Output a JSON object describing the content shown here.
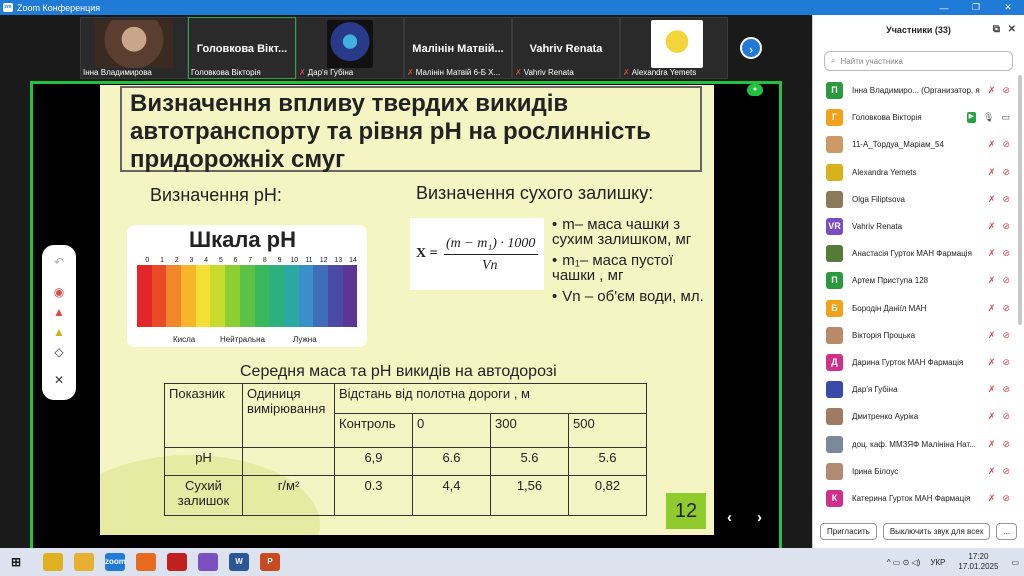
{
  "window": {
    "title": "Zoom Конференция",
    "app_icon_text": "zm"
  },
  "window_buttons": {
    "minimize": "—",
    "maximize": "❐",
    "close": "✕"
  },
  "thumbnails": [
    {
      "big_name": "",
      "caption": "Інна Владимирова",
      "muted": false
    },
    {
      "big_name": "Головкова Вікт...",
      "caption": "Головкова Вікторія",
      "muted": false
    },
    {
      "big_name": "",
      "caption": "Дар'я Губіна",
      "muted": true
    },
    {
      "big_name": "Малінін Матвій...",
      "caption": "Малінін Матвій 6-Б Х...",
      "muted": true
    },
    {
      "big_name": "Vahriv Renata",
      "caption": "Vahriv Renata",
      "muted": true
    },
    {
      "big_name": "",
      "caption": "Alexandra Yemets",
      "muted": true
    }
  ],
  "next_page_icon": "›",
  "slide": {
    "title": "Визначення впливу твердих викидів автотранспорту та рівня рН на рослинність придорожніх смуг",
    "heading_ph": "Визначення рН:",
    "heading_dry": "Визначення сухого залишку:",
    "scale_title": "Шкала рН",
    "scale_numbers": [
      "0",
      "1",
      "2",
      "3",
      "4",
      "5",
      "6",
      "7",
      "8",
      "9",
      "10",
      "11",
      "12",
      "13",
      "14"
    ],
    "scale_colors": [
      "#e3262a",
      "#ea4a26",
      "#f2862a",
      "#f7b52b",
      "#f4e034",
      "#c8dc2e",
      "#8ccf33",
      "#5cc245",
      "#3ab75a",
      "#2fae7e",
      "#2ca8a4",
      "#3a8fc8",
      "#3f6db8",
      "#4a4ba4",
      "#5b3595"
    ],
    "scale_acid": "Кисла",
    "scale_neutral": "Нейтральна",
    "scale_alkaline": "Лужна",
    "formula_x": "X =",
    "formula_num": "(m − m₁) · 1000",
    "formula_den": "Vn",
    "bullets": [
      "m– маса чашки з сухим залишком, мг",
      "m₁– маса пустої чашки , мг",
      "Vn – об'єм води, мл."
    ],
    "table_caption": "Середня маса та рН викидів на автодорозі",
    "table": {
      "h_indicator": "Показник",
      "h_unit": "Одиниця вимірювання",
      "h_distance": "Відстань від полотна дороги , м",
      "cols": [
        "Контроль",
        "0",
        "300",
        "500"
      ],
      "rows": [
        {
          "name": "pH",
          "unit": "",
          "values": [
            "6,9",
            "6.6",
            "5.6",
            "5.6"
          ]
        },
        {
          "name": "Сухий залишок",
          "unit": "г/м²",
          "values": [
            "0.3",
            "4,4",
            "1,56",
            "0,82"
          ]
        }
      ]
    },
    "page_number": "12",
    "prev_icon": "‹",
    "next_icon": "›"
  },
  "annotation_tools": {
    "undo": "↶",
    "spotlight": "◉",
    "pen": "▲",
    "highlighter": "▲",
    "eraser": "◇",
    "close": "✕"
  },
  "panel": {
    "title": "Участники (33)",
    "search_placeholder": "Найти участника",
    "search_icon": "⌕",
    "popout_icon": "⧉",
    "close_icon": "✕",
    "participants": [
      {
        "initial": "П",
        "color": "#2b9a3e",
        "name": "Інна Владимиро... (Организатор, я)",
        "mic": "off",
        "cam": "off"
      },
      {
        "initial": "Г",
        "color": "#f0a21a",
        "name": "Головкова Вікторія",
        "mic": "on",
        "cam": "on"
      },
      {
        "initial": "",
        "color": "#c96",
        "name": "11-А_Тордуа_Маріам_54",
        "mic": "off",
        "cam": "off"
      },
      {
        "initial": "",
        "color": "#d8b21a",
        "name": "Alexandra Yemets",
        "mic": "off",
        "cam": "off"
      },
      {
        "initial": "",
        "color": "#8a7a5a",
        "name": "Olga Filiptsova",
        "mic": "off",
        "cam": "off"
      },
      {
        "initial": "VR",
        "color": "#7a4cc0",
        "name": "Vahriv Renata",
        "mic": "off",
        "cam": "off"
      },
      {
        "initial": "",
        "color": "#557a3a",
        "name": "Анастасія Гурток МАН Фармація",
        "mic": "off",
        "cam": "off"
      },
      {
        "initial": "П",
        "color": "#2b9a3e",
        "name": "Артем Приступа 128",
        "mic": "off",
        "cam": "off"
      },
      {
        "initial": "Б",
        "color": "#f0a21a",
        "name": "Бородін Даніїл МАН",
        "mic": "off",
        "cam": "off"
      },
      {
        "initial": "",
        "color": "#b98a6a",
        "name": "Вікторія Процька",
        "mic": "off",
        "cam": "off"
      },
      {
        "initial": "Д",
        "color": "#d0308a",
        "name": "Дарина Гурток МАН Фармація",
        "mic": "off",
        "cam": "off"
      },
      {
        "initial": "",
        "color": "#3a4aa8",
        "name": "Дар'я Губіна",
        "mic": "off",
        "cam": "off"
      },
      {
        "initial": "",
        "color": "#a07a62",
        "name": "Дмитренко Ауріка",
        "mic": "off",
        "cam": "off"
      },
      {
        "initial": "",
        "color": "#7a8a9a",
        "name": "доц. каф. ММЗЯФ Малініна Нат...",
        "mic": "off",
        "cam": "off"
      },
      {
        "initial": "",
        "color": "#b08a72",
        "name": "Ірина Білоус",
        "mic": "off",
        "cam": "off"
      },
      {
        "initial": "К",
        "color": "#d0308a",
        "name": "Катерина Гурток МАН Фармація",
        "mic": "off",
        "cam": "off"
      }
    ],
    "invite_label": "Пригласить",
    "mute_all_label": "Выключить звук для всех",
    "more_label": "..."
  },
  "taskbar": {
    "start_icon": "⊞",
    "apps": [
      {
        "name": "chrome",
        "label": "",
        "color": "#e0b020"
      },
      {
        "name": "explorer",
        "label": "",
        "color": "#e8b030"
      },
      {
        "name": "zoom",
        "label": "zoom",
        "color": "#1f7bd6"
      },
      {
        "name": "firefox",
        "label": "",
        "color": "#e86a20"
      },
      {
        "name": "app-red",
        "label": "",
        "color": "#c02020"
      },
      {
        "name": "viber",
        "label": "",
        "color": "#7b4fbf"
      },
      {
        "name": "word",
        "label": "W",
        "color": "#2b5797"
      },
      {
        "name": "powerpoint",
        "label": "P",
        "color": "#c84a20"
      }
    ],
    "lang": "УКР",
    "time": "17:20",
    "date": "17.01.2025",
    "tray_icons": "^ ▭ ⊙ ◁)",
    "notify_icon": "▭"
  }
}
